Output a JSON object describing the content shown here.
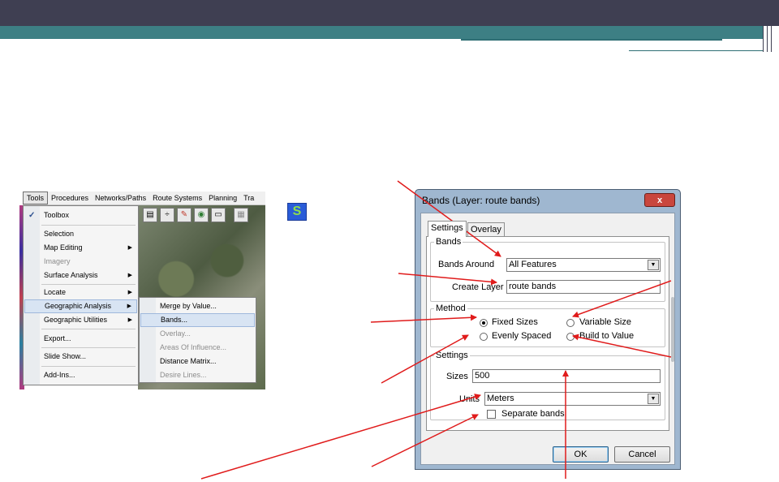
{
  "menubar": {
    "items": [
      "Tools",
      "Procedures",
      "Networks/Paths",
      "Route Systems",
      "Planning",
      "Tra"
    ]
  },
  "tools_menu": {
    "toolbox": "Toolbox",
    "selection": "Selection",
    "map_editing": "Map Editing",
    "imagery": "Imagery",
    "surface_analysis": "Surface Analysis",
    "locate": "Locate",
    "geographic_analysis": "Geographic Analysis",
    "geographic_utilities": "Geographic Utilities",
    "export": "Export...",
    "slide_show": "Slide Show...",
    "add_ins": "Add-Ins..."
  },
  "submenu": {
    "merge_by_value": "Merge by Value...",
    "bands": "Bands...",
    "overlay": "Overlay...",
    "areas_of_influence": "Areas Of Influence...",
    "distance_matrix": "Distance Matrix...",
    "desire_lines": "Desire Lines..."
  },
  "toolbar": {
    "icons": [
      "table-icon",
      "fraction-icon",
      "pencil-icon",
      "globe-icon",
      "rectangle-icon",
      "map-icon"
    ]
  },
  "dialog": {
    "title": "Bands (Layer: route bands)",
    "close_label": "x",
    "tabs": [
      "Settings",
      "Overlay"
    ],
    "bands_group": {
      "legend": "Bands",
      "bands_around_label": "Bands Around",
      "bands_around_value": "All Features",
      "create_layer_label": "Create Layer",
      "create_layer_value": "route bands"
    },
    "method_group": {
      "legend": "Method",
      "fixed_sizes": "Fixed Sizes",
      "variable_size": "Variable Size",
      "evenly_spaced": "Evenly Spaced",
      "build_to_value": "Build to Value",
      "selected": "Fixed Sizes"
    },
    "settings_group": {
      "legend": "Settings",
      "sizes_label": "Sizes",
      "sizes_value": "500",
      "units_label": "Units",
      "units_value": "Meters",
      "separate_bands_label": "Separate bands",
      "separate_bands_checked": false
    },
    "ok_label": "OK",
    "cancel_label": "Cancel"
  },
  "colors": {
    "header_dark": "#3f3f52",
    "header_teal": "#3d7f84",
    "annotation_arrow": "#e01b1b",
    "menu_highlight": "#d8e4f3"
  }
}
